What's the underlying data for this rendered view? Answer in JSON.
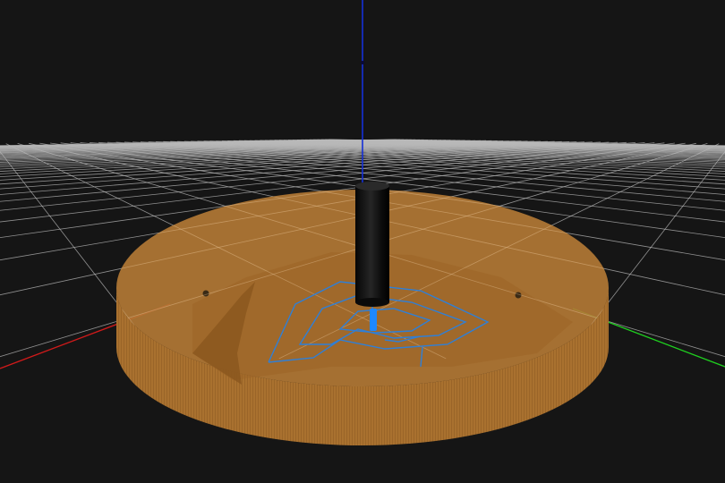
{
  "viewport": {
    "background": "#151515",
    "grid_color": "#b9b9b9",
    "axis_colors": {
      "x": "#d01a1a",
      "y": "#1fd01f",
      "z": "#1530d8"
    },
    "stock_color": "#b57a35",
    "stock_side_color": "#a8722f",
    "toolpath_color": "#2f7fd6",
    "tool_color": "#111111",
    "tool_tip_color": "#1e88ff",
    "icons": [
      "workpiece-stock",
      "cutting-tool",
      "toolpath",
      "origin-axes",
      "floor-grid"
    ]
  }
}
